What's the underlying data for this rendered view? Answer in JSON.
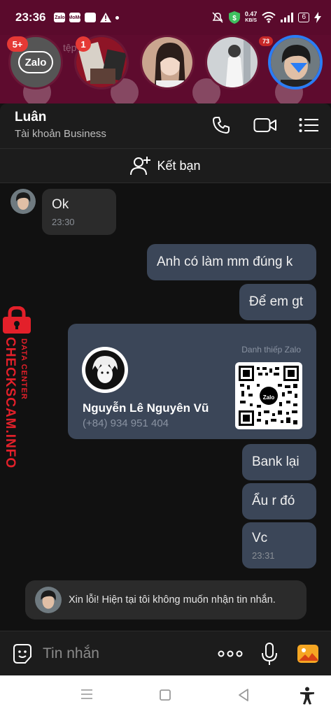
{
  "status_bar": {
    "time": "23:36",
    "speed_value": "0.47",
    "speed_unit": "KB/S",
    "battery": "6",
    "apps": [
      "Zalo",
      "MoMo"
    ]
  },
  "top_bubbles": {
    "zalo_badge": "5+",
    "zalo_label": "Zalo",
    "second_badge": "1",
    "last_badge": "73",
    "ghost_text": "tệp chỉ"
  },
  "header": {
    "name": "Luân",
    "subtitle": "Tài khoản Business"
  },
  "add_friend": {
    "label": "Kết bạn"
  },
  "messages": [
    {
      "text": "Ok",
      "time": "23:30"
    },
    {
      "text": "Anh có làm mm đúng k"
    },
    {
      "text": "Để em gt"
    },
    {
      "text": "Bank lại"
    },
    {
      "text": "Ẩu r đó"
    },
    {
      "text": "Vc",
      "time": "23:31"
    }
  ],
  "contact_card": {
    "label": "Danh thiếp Zalo",
    "name": "Nguyễn Lê Nguyên Vũ",
    "phone": "(+84) 934 951 404",
    "qr_logo": "Zalo"
  },
  "notice": {
    "text": "Xin lỗi! Hiện tại tôi không muốn nhận tin nhắn."
  },
  "watermark": {
    "line1": "DATA CENTER",
    "line2": "CHECKSCAM.INFO"
  },
  "input": {
    "placeholder": "Tin nhắn"
  },
  "colors": {
    "accent": "#2a7df5",
    "statusbar": "#5a0a2c",
    "outgoing_bubble": "#3b4658",
    "incoming_bubble": "#2b2b2b",
    "watermark_red": "#e3202a"
  }
}
